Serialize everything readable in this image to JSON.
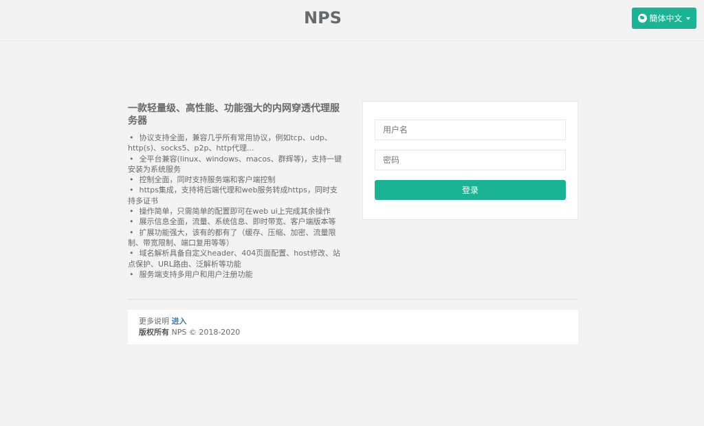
{
  "header": {
    "brand": "NPS",
    "language_label": "簡体中文"
  },
  "intro": {
    "title": "一款轻量级、高性能、功能强大的内网穿透代理服务器",
    "features": [
      "协议支持全面，兼容几乎所有常用协议，例如tcp、udp、http(s)、socks5、p2p、http代理...",
      "全平台兼容(linux、windows、macos、群辉等)，支持一键安装为系统服务",
      "控制全面，同时支持服务端和客户端控制",
      "https集成，支持将后端代理和web服务转成https，同时支持多证书",
      "操作简单，只需简单的配置即可在web ui上完成其余操作",
      "展示信息全面，流量、系统信息、即时带宽、客户端版本等",
      "扩展功能强大，该有的都有了（缓存、压缩、加密、流量限制、带宽限制、端口复用等等）",
      "域名解析具备自定义header、404页面配置、host修改、站点保护、URL路由、泛解析等功能",
      "服务端支持多用户和用户注册功能"
    ]
  },
  "login": {
    "username_placeholder": "用户名",
    "password_placeholder": "密码",
    "submit_label": "登录"
  },
  "footer": {
    "more_text": "更多说明",
    "more_link": "进入",
    "copyright_label": "版权所有",
    "copyright_text": "NPS © 2018-2020"
  },
  "colors": {
    "accent": "#1ab394",
    "background": "#f3f3f4",
    "link": "#337ab7"
  }
}
